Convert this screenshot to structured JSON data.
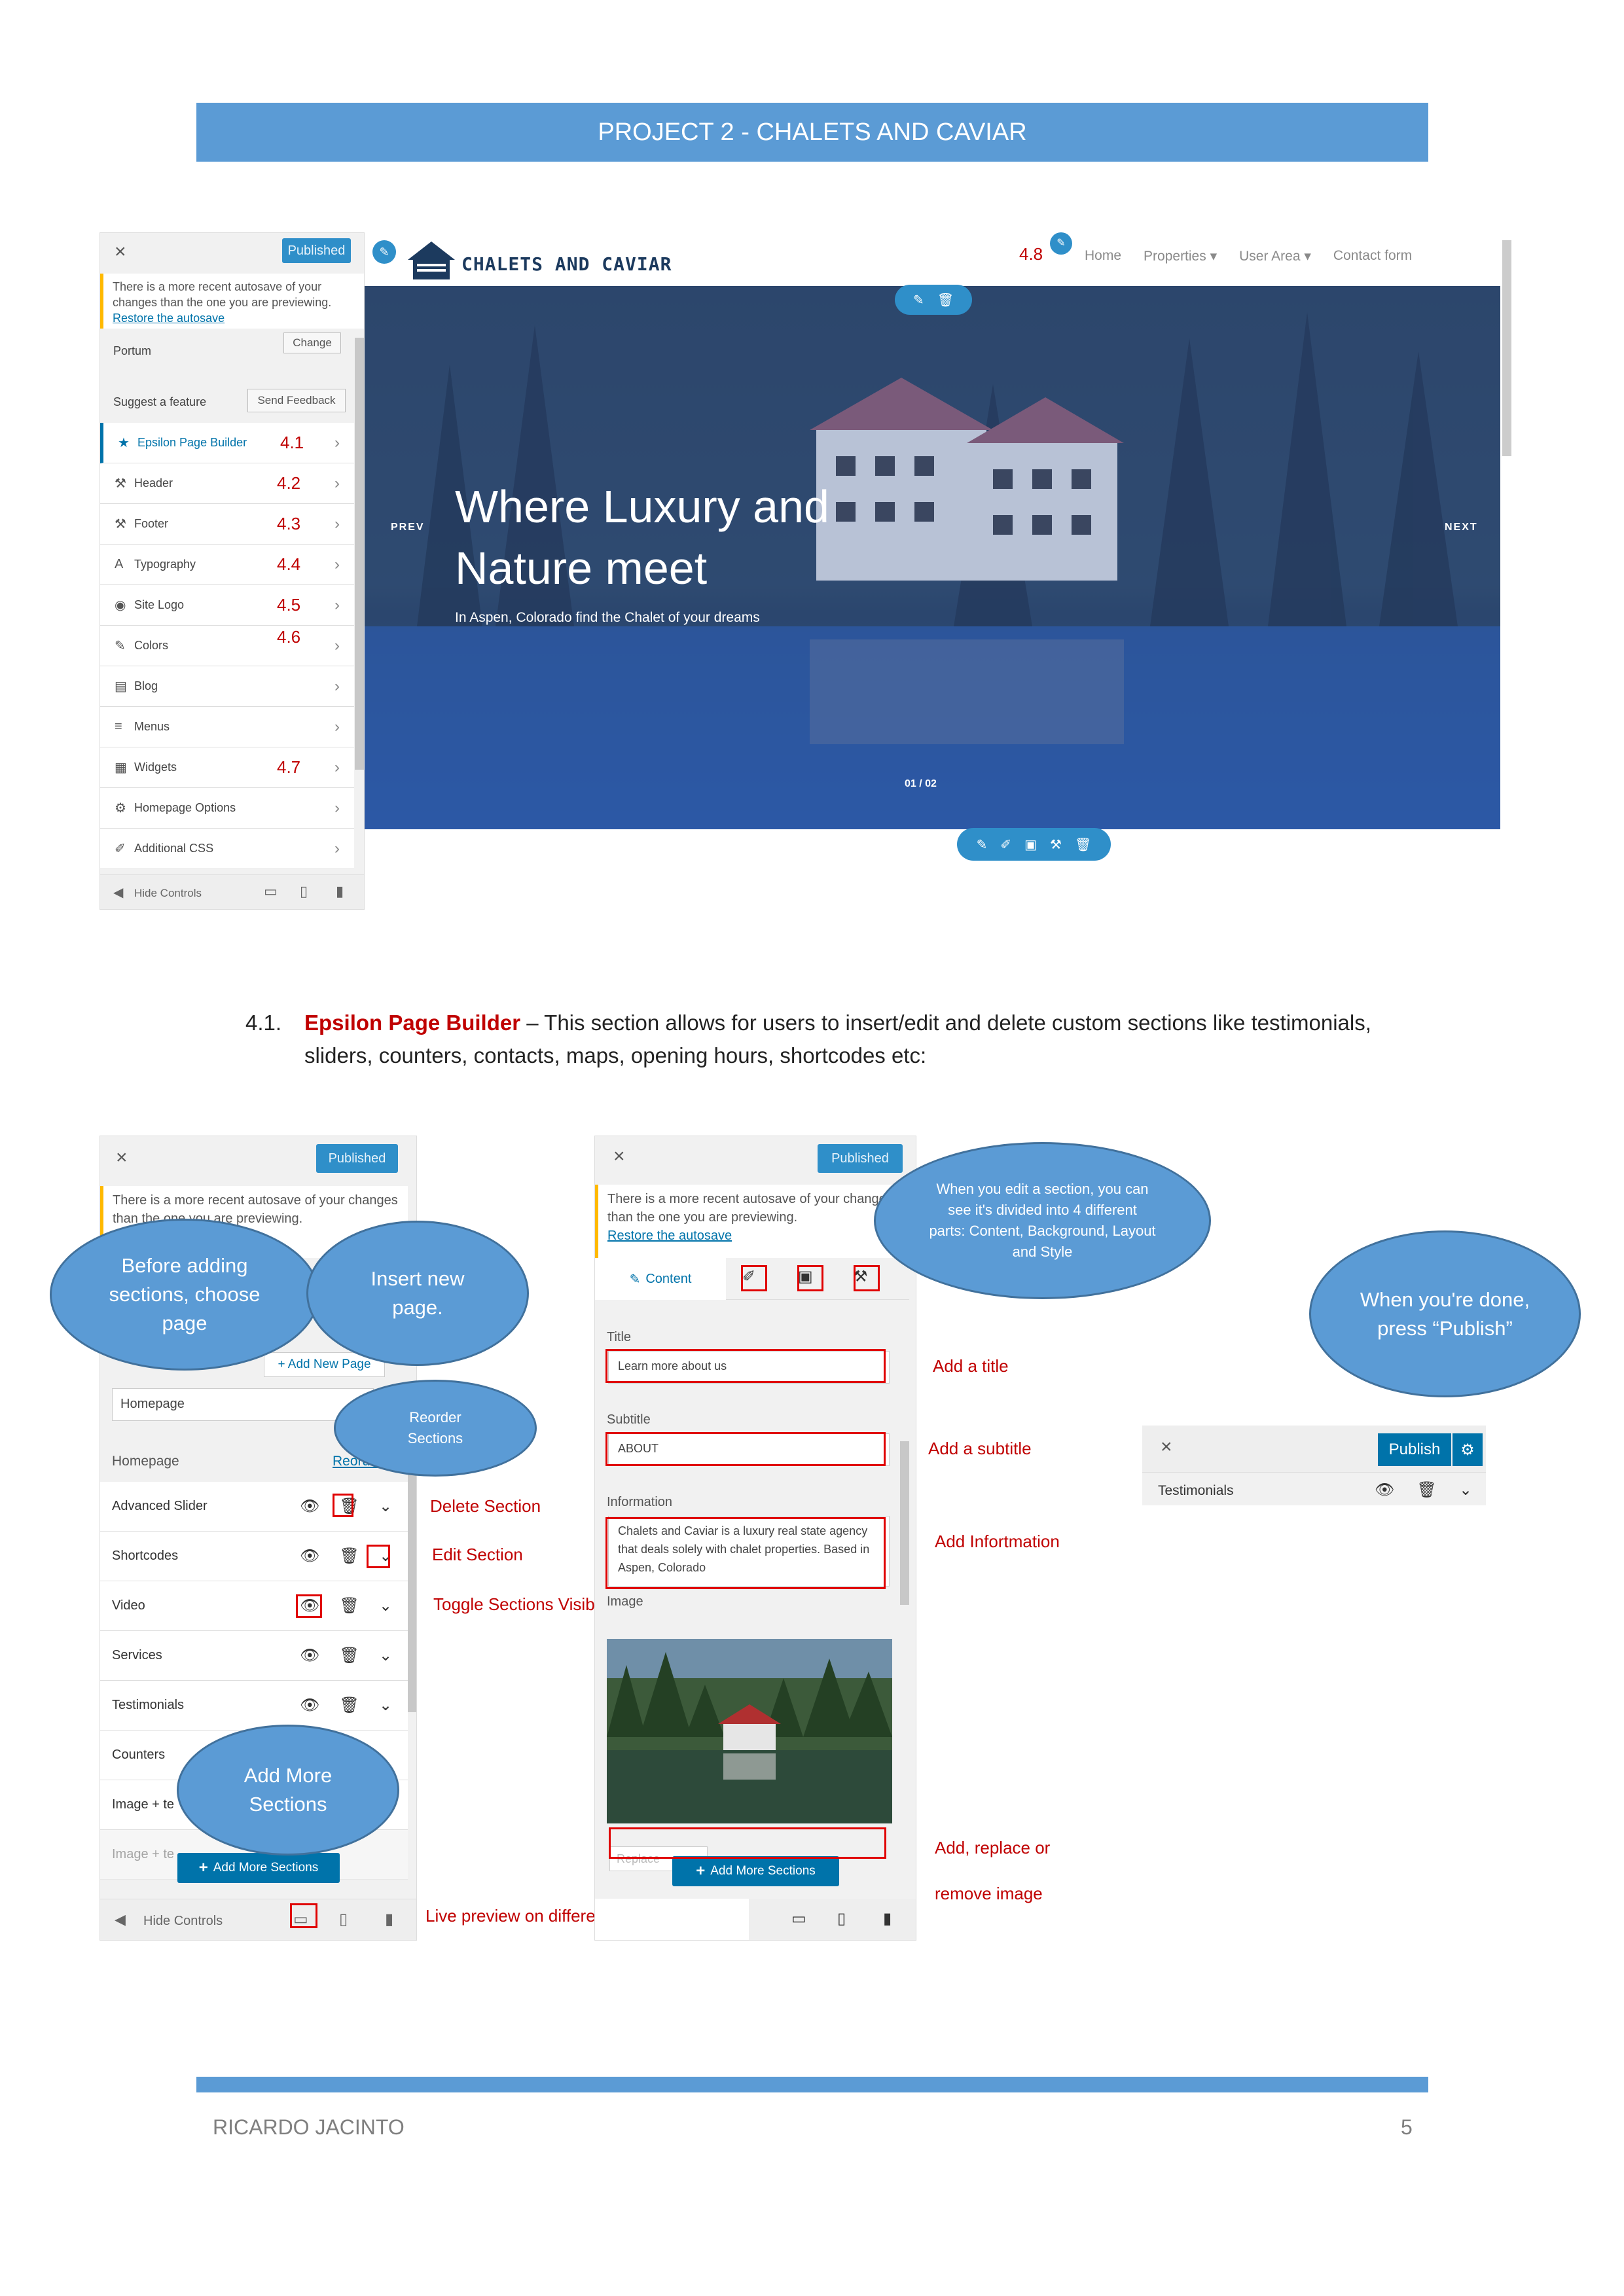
{
  "header": {
    "title": "PROJECT 2 - CHALETS AND CAVIAR"
  },
  "colors": {
    "accent": "#5b9bd5",
    "annotation_red": "#c00000",
    "wp_blue": "#2f8fc9"
  },
  "screenshot1": {
    "sidebar": {
      "close": "×",
      "published": "Published",
      "notice": "There is a more recent autosave of your changes than the one you are previewing.",
      "notice_link": "Restore the autosave",
      "theme_name": "Portum",
      "change_button": "Change",
      "suggest_label": "Suggest a feature",
      "feedback_button": "Send Feedback",
      "items": [
        {
          "icon": "star-icon",
          "glyph": "★",
          "label": "Epsilon Page Builder",
          "num": "4.1"
        },
        {
          "icon": "hammer-icon",
          "glyph": "🔨",
          "label": "Header",
          "num": "4.2"
        },
        {
          "icon": "hammer-icon",
          "glyph": "🔨",
          "label": "Footer",
          "num": "4.3"
        },
        {
          "icon": "typography-icon",
          "glyph": "A",
          "label": "Typography",
          "num": "4.4"
        },
        {
          "icon": "globe-icon",
          "glyph": "◉",
          "label": "Site Logo",
          "num": "4.5"
        },
        {
          "icon": "paint-icon",
          "glyph": "✎",
          "label": "Colors",
          "num": "4.6"
        },
        {
          "icon": "blog-icon",
          "glyph": "▤",
          "label": "Blog",
          "num": ""
        },
        {
          "icon": "menu-icon",
          "glyph": "≡",
          "label": "Menus",
          "num": ""
        },
        {
          "icon": "widgets-icon",
          "glyph": "▦",
          "label": "Widgets",
          "num": "4.7"
        },
        {
          "icon": "gear-icon",
          "glyph": "⚙",
          "label": "Homepage Options",
          "num": ""
        },
        {
          "icon": "css-icon",
          "glyph": "✐",
          "label": "Additional CSS",
          "num": ""
        }
      ],
      "hide_controls": "Hide Controls"
    },
    "site": {
      "logo_text": "CHALETS AND CAVIAR",
      "nav_num": "4.8",
      "nav": [
        "Home",
        "Properties",
        "User Area",
        "Contact form"
      ],
      "hero_title_1": "Where Luxury and",
      "hero_title_2": "Nature meet",
      "hero_sub": "In Aspen, Colorado find the Chalet of your dreams",
      "prev": "PREV",
      "next": "NEXT",
      "pager": "01 / 02"
    }
  },
  "section41": {
    "number": "4.1.",
    "title": "Epsilon Page Builder",
    "text1": " – This section allows for users to insert/edit and delete custom sections like testimonials,",
    "text2": "sliders, counters, contacts, maps, opening hours, shortcodes etc:"
  },
  "screenshot2": {
    "published": "Published",
    "notice": "There is a more recent autosave of your changes than the one you are previewing.",
    "add_new_page": "+ Add New Page",
    "page_value": "Homepage",
    "sections_heading": "Homepage",
    "reorder": "Reorder",
    "sections": [
      "Advanced Slider",
      "Shortcodes",
      "Video",
      "Services",
      "Testimonials",
      "Counters",
      "Image + te",
      "Image + te"
    ],
    "add_more": "Add More Sections",
    "hide_controls": "Hide Controls"
  },
  "screenshot3": {
    "published": "Published",
    "notice": "There is a more recent autosave of your changes than the one you are previewing.",
    "notice_link": "Restore the autosave",
    "tab_content": "Content",
    "title_label": "Title",
    "title_value": "Learn more about us",
    "subtitle_label": "Subtitle",
    "subtitle_value": "ABOUT",
    "info_label": "Information",
    "info_value": "Chalets and Caviar is a luxury real state agency that deals solely with chalet properties. Based in Aspen, Colorado",
    "image_label": "Image",
    "replace": "Replace",
    "add_more": "Add More Sections"
  },
  "screenshot4": {
    "publish": "Publish",
    "item": "Testimonials"
  },
  "bubbles": {
    "before_adding": "Before adding sections, choose page",
    "insert_page": "Insert new page.",
    "reorder": "Reorder Sections",
    "add_more": "Add More Sections",
    "edit_parts": "When you edit a section, you can see it's divided into 4 different parts: Content, Background, Layout and Style",
    "publish": "When you're done, press “Publish”"
  },
  "labels": {
    "delete": "Delete Section",
    "edit": "Edit Section",
    "toggle": "Toggle Sections Visibility",
    "live_preview": "Live preview on different view ports",
    "add_title": "Add a title",
    "add_subtitle": "Add a subtitle",
    "add_info": "Add Infortmation",
    "add_replace_1": "Add, replace or",
    "add_replace_2": "remove image"
  },
  "footer": {
    "author": "RICARDO JACINTO",
    "page": "5"
  }
}
